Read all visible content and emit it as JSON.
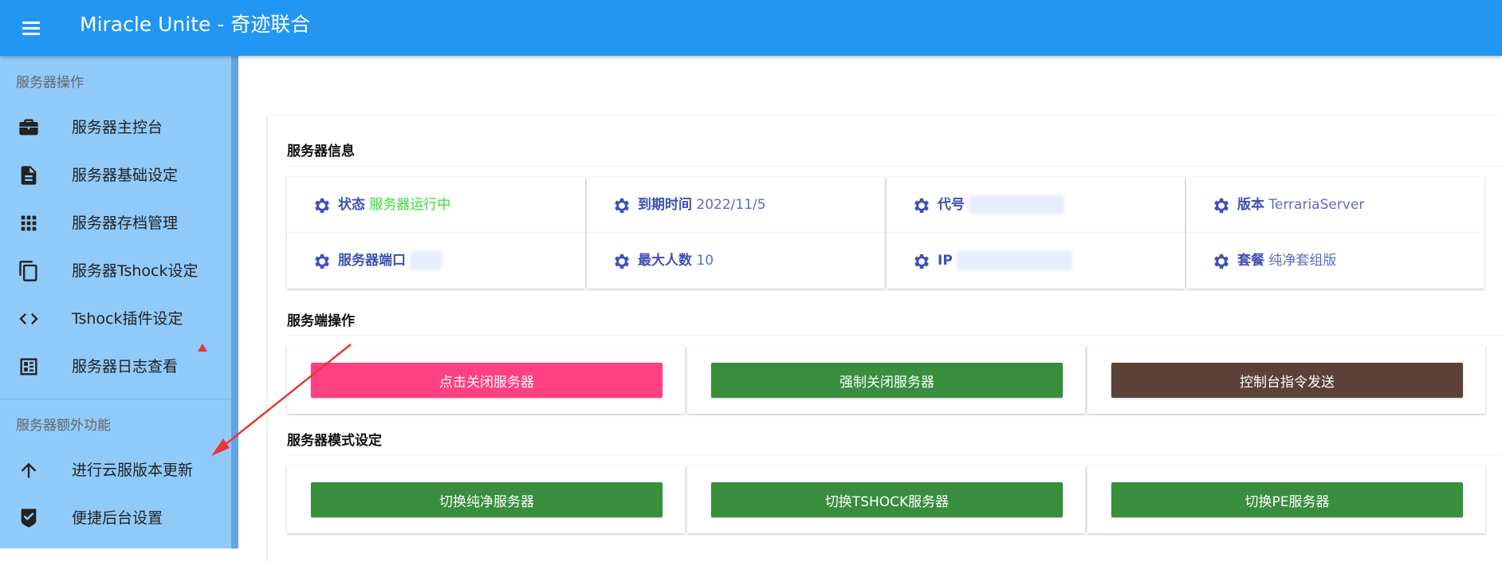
{
  "app": {
    "title": "Miracle Unite - 奇迹联合"
  },
  "sidebar": {
    "sections": [
      {
        "subheader": "服务器操作"
      },
      {
        "subheader": "服务器额外功能"
      }
    ],
    "items": [
      {
        "label": "服务器主控台",
        "icon": "briefcase-icon"
      },
      {
        "label": "服务器基础设定",
        "icon": "document-icon"
      },
      {
        "label": "服务器存档管理",
        "icon": "grid-icon"
      },
      {
        "label": "服务器Tshock设定",
        "icon": "copy-icon"
      },
      {
        "label": "Tshock插件设定",
        "icon": "code-icon"
      },
      {
        "label": "服务器日志查看",
        "icon": "log-icon"
      },
      {
        "label": "进行云服版本更新",
        "icon": "arrow-up-icon"
      },
      {
        "label": "便捷后台设置",
        "icon": "shield-check-icon"
      }
    ]
  },
  "server_info": {
    "title": "服务器信息",
    "tiles": [
      {
        "label": "状态",
        "value": "服务器运行中"
      },
      {
        "label": "到期时间",
        "value": "2022/11/5"
      },
      {
        "label": "代号",
        "value": ""
      },
      {
        "label": "版本",
        "value": "TerrariaServer"
      },
      {
        "label": "服务器端口",
        "value": ""
      },
      {
        "label": "最大人数",
        "value": "10"
      },
      {
        "label": "IP",
        "value": ""
      },
      {
        "label": "套餐",
        "value": "纯净套组版"
      }
    ]
  },
  "server_ops": {
    "title": "服务端操作",
    "buttons": [
      {
        "label": "点击关闭服务器"
      },
      {
        "label": "强制关闭服务器"
      },
      {
        "label": "控制台指令发送"
      }
    ]
  },
  "server_mode": {
    "title": "服务器模式设定",
    "buttons": [
      {
        "label": "切换纯净服务器"
      },
      {
        "label": "切换TSHOCK服务器"
      },
      {
        "label": "切换PE服务器"
      }
    ]
  },
  "colors": {
    "appbar": "#2196f3",
    "sidebar": "#90caf9",
    "accent_label": "#3f51b5",
    "status_green": "#33dd33",
    "btn_pink": "#ff4081",
    "btn_green": "#388e3c",
    "btn_brown": "#5d4037",
    "annotation_red": "#e53935"
  }
}
